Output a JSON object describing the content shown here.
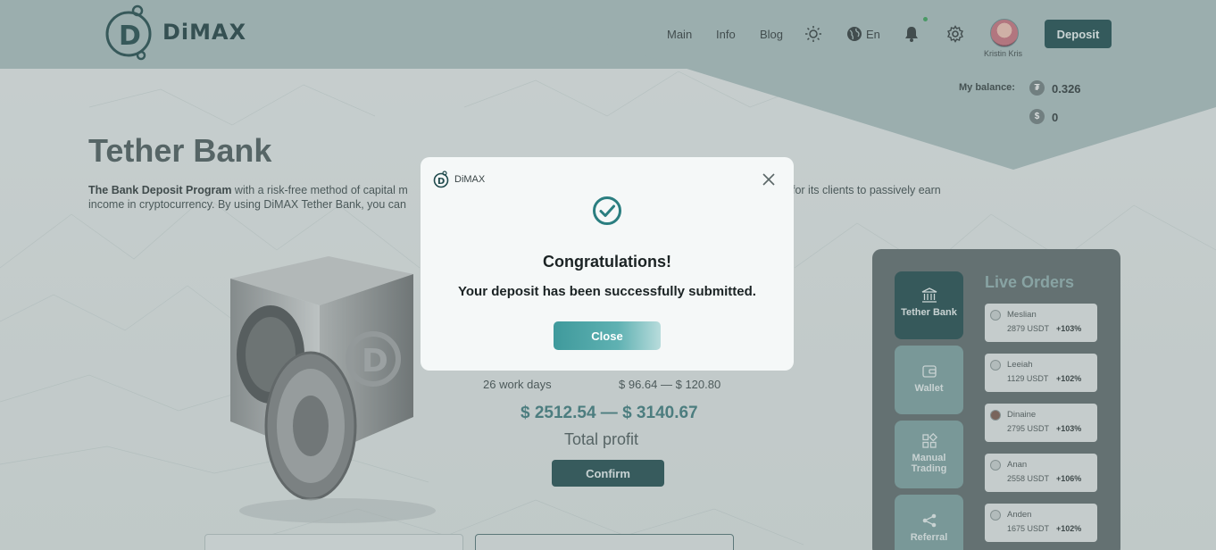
{
  "header": {
    "logo_text": "DiMAX",
    "nav": [
      "Main",
      "Info",
      "Blog"
    ],
    "language": "En",
    "user_name": "Kristin Kris",
    "deposit_label": "Deposit",
    "icons": [
      "sun-icon",
      "globe-icon",
      "bell-icon",
      "gear-icon"
    ]
  },
  "balance": {
    "label": "My balance:",
    "tether_value": "0.326",
    "dollar_value": "0"
  },
  "main": {
    "title": "Tether Bank",
    "intro_bold": "The Bank Deposit Program",
    "intro_part1": " with a risk-free method of capital m",
    "intro_tail1": "for its clients to passively earn",
    "intro_line2": "income in cryptocurrency. By using DiMAX Tether Bank, you can",
    "duration": "26 work days",
    "daily_range": "$ 96.64 — $ 120.80",
    "profit_range": "$ 2512.54 — $ 3140.67",
    "total_profit_label": "Total profit",
    "confirm_label": "Confirm"
  },
  "side_panel": {
    "tabs": [
      {
        "label": "Tether Bank",
        "icon": "bank-icon",
        "active": true
      },
      {
        "label": "Wallet",
        "icon": "wallet-icon",
        "active": false
      },
      {
        "label": "Manual Trading",
        "icon": "grid-icon",
        "active": false
      },
      {
        "label": "Referral",
        "icon": "share-icon",
        "active": false
      }
    ],
    "live_title": "Live Orders",
    "orders": [
      {
        "name": "Meslian",
        "amount": "2879 USDT",
        "pct": "+103%"
      },
      {
        "name": "Leeiah",
        "amount": "1129 USDT",
        "pct": "+102%"
      },
      {
        "name": "Dinaine",
        "amount": "2795 USDT",
        "pct": "+103%"
      },
      {
        "name": "Anan",
        "amount": "2558 USDT",
        "pct": "+106%"
      },
      {
        "name": "Anden",
        "amount": "1675 USDT",
        "pct": "+102%"
      }
    ]
  },
  "modal": {
    "brand": "DiMAX",
    "title": "Congratulations!",
    "message": "Your deposit has been successfully submitted.",
    "close_label": "Close"
  },
  "colors": {
    "accent": "#1e4a4d",
    "teal": "#3f9a9c",
    "header_bg": "#a9bfc0"
  }
}
